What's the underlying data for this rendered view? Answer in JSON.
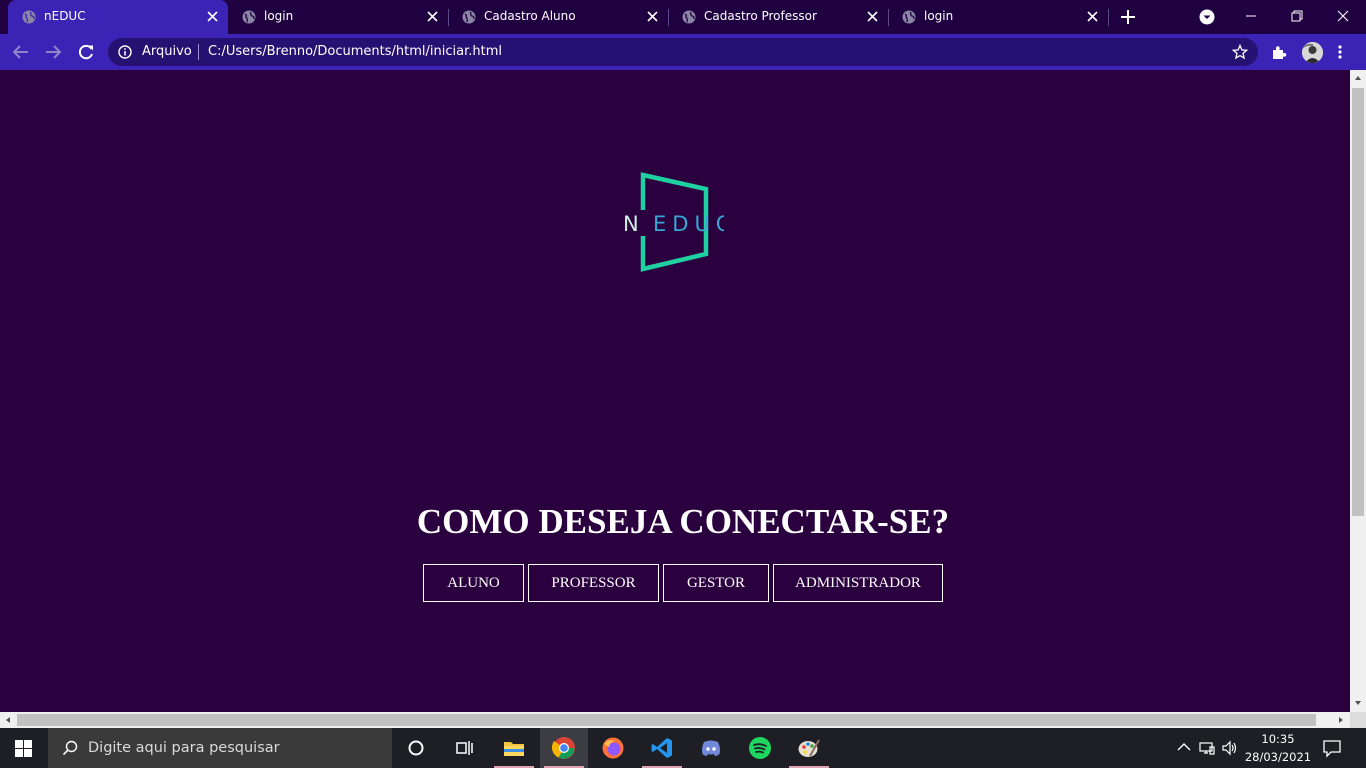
{
  "browser": {
    "tabs": [
      {
        "title": "nEDUC",
        "active": true
      },
      {
        "title": "login",
        "active": false
      },
      {
        "title": "Cadastro Aluno",
        "active": false
      },
      {
        "title": "Cadastro Professor",
        "active": false
      },
      {
        "title": "login",
        "active": false
      }
    ],
    "address_bar": {
      "scheme_label": "Arquivo",
      "url": "C:/Users/Brenno/Documents/html/iniciar.html"
    },
    "icons": {
      "back": "arrow-left-icon",
      "forward": "arrow-right-icon",
      "reload": "reload-icon",
      "info": "info-icon",
      "bookmark": "star-icon",
      "extensions": "puzzle-icon",
      "profile": "avatar",
      "menu": "kebab-menu-icon"
    },
    "colors": {
      "tabstrip": "#1f0040",
      "toolbar": "#3b23b5",
      "omnibox": "#241172"
    }
  },
  "page": {
    "logo": {
      "text_left": "N",
      "text_right": "EDUC"
    },
    "heading": "COMO DESEJA CONECTAR-SE?",
    "options": [
      "ALUNO",
      "PROFESSOR",
      "GESTOR",
      "ADMINISTRADOR"
    ],
    "colors": {
      "background": "#2b003f",
      "accent": "#1fd1a0",
      "logo_text": "#38a7d6",
      "text": "#ffffff"
    }
  },
  "taskbar": {
    "search_placeholder": "Digite aqui para pesquisar",
    "apps": [
      "file-explorer-icon",
      "chrome-icon",
      "firefox-icon",
      "vscode-icon",
      "discord-icon",
      "spotify-icon",
      "paint-icon"
    ],
    "clock": {
      "time": "10:35",
      "date": "28/03/2021"
    }
  }
}
